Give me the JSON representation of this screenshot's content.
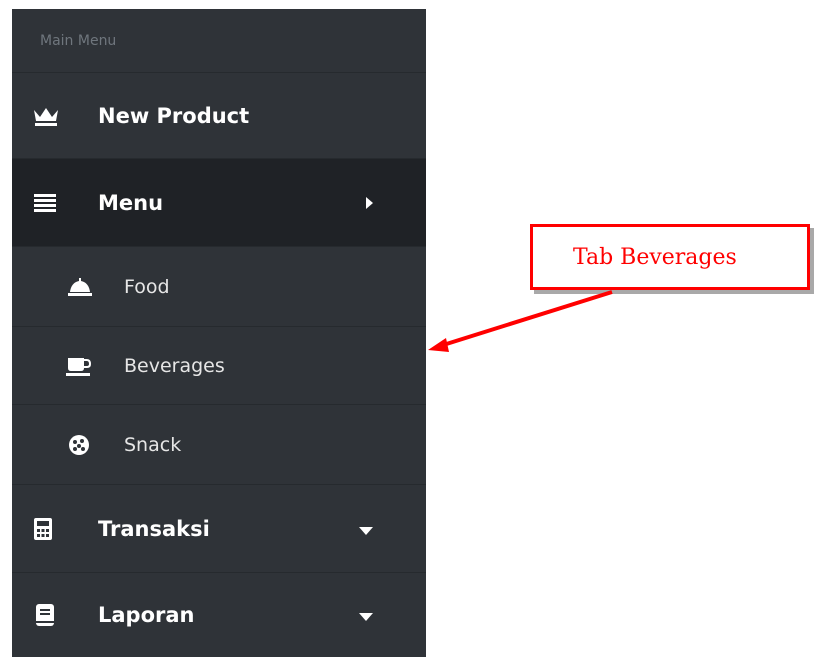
{
  "sidebar": {
    "header": "Main Menu",
    "items": [
      {
        "label": "New Product",
        "icon": "crown-icon"
      },
      {
        "label": "Menu",
        "icon": "list-icon",
        "arrow": "caret-right-icon"
      },
      {
        "label": "Food",
        "icon": "bell-icon"
      },
      {
        "label": "Beverages",
        "icon": "cup-icon"
      },
      {
        "label": "Snack",
        "icon": "snack-icon"
      },
      {
        "label": "Transaksi",
        "icon": "calculator-icon",
        "arrow": "caret-down-icon"
      },
      {
        "label": "Laporan",
        "icon": "book-icon",
        "arrow": "caret-down-icon"
      }
    ]
  },
  "callout": {
    "text": "Tab Beverages"
  },
  "colors": {
    "sidebar_bg": "#2f3338",
    "active_bg": "#1f2226",
    "callout_red": "#ff0000"
  }
}
